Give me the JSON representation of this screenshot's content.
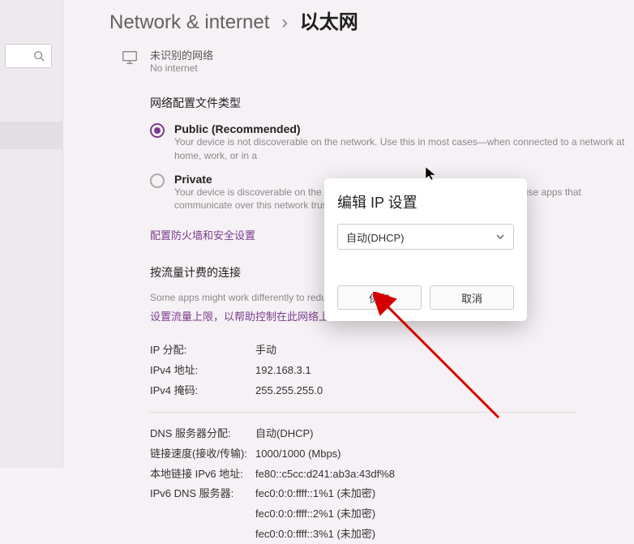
{
  "breadcrumb": {
    "root": "Network & internet",
    "current": "以太网"
  },
  "status": {
    "line1_cn": "未识别的网络",
    "line2": "No internet"
  },
  "profile_section": {
    "title": "网络配置文件类型",
    "public": {
      "label": "Public (Recommended)",
      "desc": "Your device is not discoverable on the network. Use this in most cases—when connected to a network at home, work, or in a"
    },
    "private": {
      "label": "Private",
      "desc": "Your device is discoverable on the network. Select this if you need file sharing or use apps that communicate over this network trust the people and devices on the network."
    },
    "firewall_link": "配置防火墙和安全设置"
  },
  "metered_section": {
    "title": "按流量计费的连接",
    "desc": "Some apps might work differently to reduce d",
    "limit_link": "设置流量上限，以帮助控制在此网络上的"
  },
  "details": {
    "ip_assign_key": "IP 分配:",
    "ip_assign_val": "手动",
    "ipv4_addr_key": "IPv4 地址:",
    "ipv4_addr_val": "192.168.3.1",
    "ipv4_mask_key": "IPv4 掩码:",
    "ipv4_mask_val": "255.255.255.0",
    "dns_assign_key": "DNS 服务器分配:",
    "dns_assign_val": "自动(DHCP)",
    "link_speed_key": "链接速度(接收/传输):",
    "link_speed_val": "1000/1000 (Mbps)",
    "ipv6_local_key": "本地链接 IPv6 地址:",
    "ipv6_local_val": "fe80::c5cc:d241:ab3a:43df%8",
    "ipv6_dns_key": "IPv6 DNS 服务器:",
    "ipv6_dns_val1": "fec0:0:0:ffff::1%1 (未加密)",
    "ipv6_dns_val2": "fec0:0:0:ffff::2%1 (未加密)",
    "ipv6_dns_val3": "fec0:0:0:ffff::3%1 (未加密)"
  },
  "modal": {
    "title": "编辑 IP 设置",
    "select_value": "自动(DHCP)",
    "save": "保存",
    "cancel": "取消"
  },
  "colors": {
    "accent": "#7a3e8c"
  }
}
